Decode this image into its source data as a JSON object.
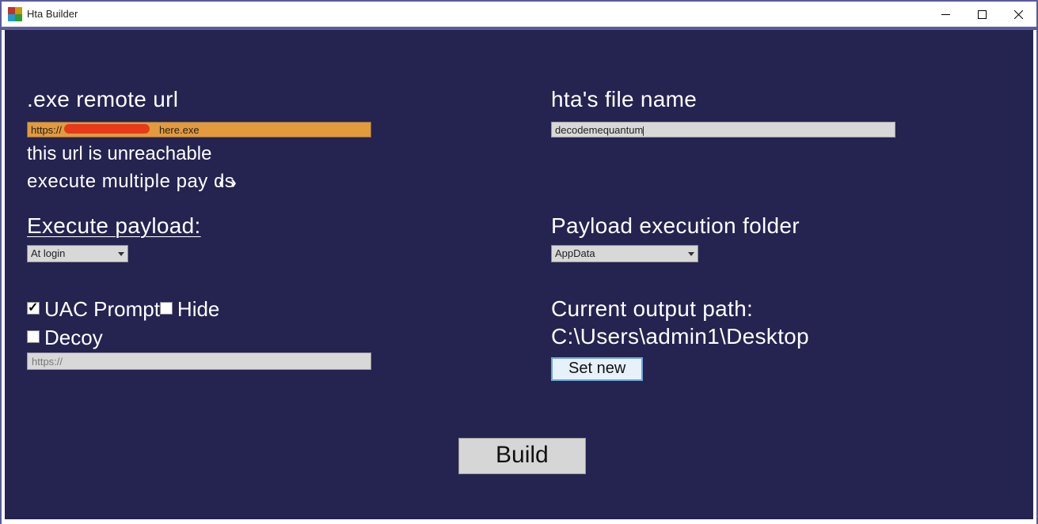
{
  "window": {
    "title": "Hta Builder"
  },
  "left": {
    "remote_url_label": ".exe remote url",
    "remote_url_value_prefix": "https://",
    "remote_url_value_suffix": "here.exe",
    "remote_url_status": "this url is unreachable",
    "multi_payload_line": "execute multiple pay       ds",
    "execute_payload_label": "Execute payload:",
    "execute_payload_value": "At login",
    "uac_label": "UAC Prompt",
    "hide_label": "Hide",
    "decoy_label": "Decoy",
    "decoy_url_value": "https://"
  },
  "right": {
    "filename_label": "hta's file name",
    "filename_value": "decodemequantum",
    "exec_folder_label": "Payload execution folder",
    "exec_folder_value": "AppData",
    "output_path_label": "Current output path:",
    "output_path_value": "C:\\Users\\admin1\\Desktop",
    "set_new_label": "Set new"
  },
  "build_label": "Build"
}
